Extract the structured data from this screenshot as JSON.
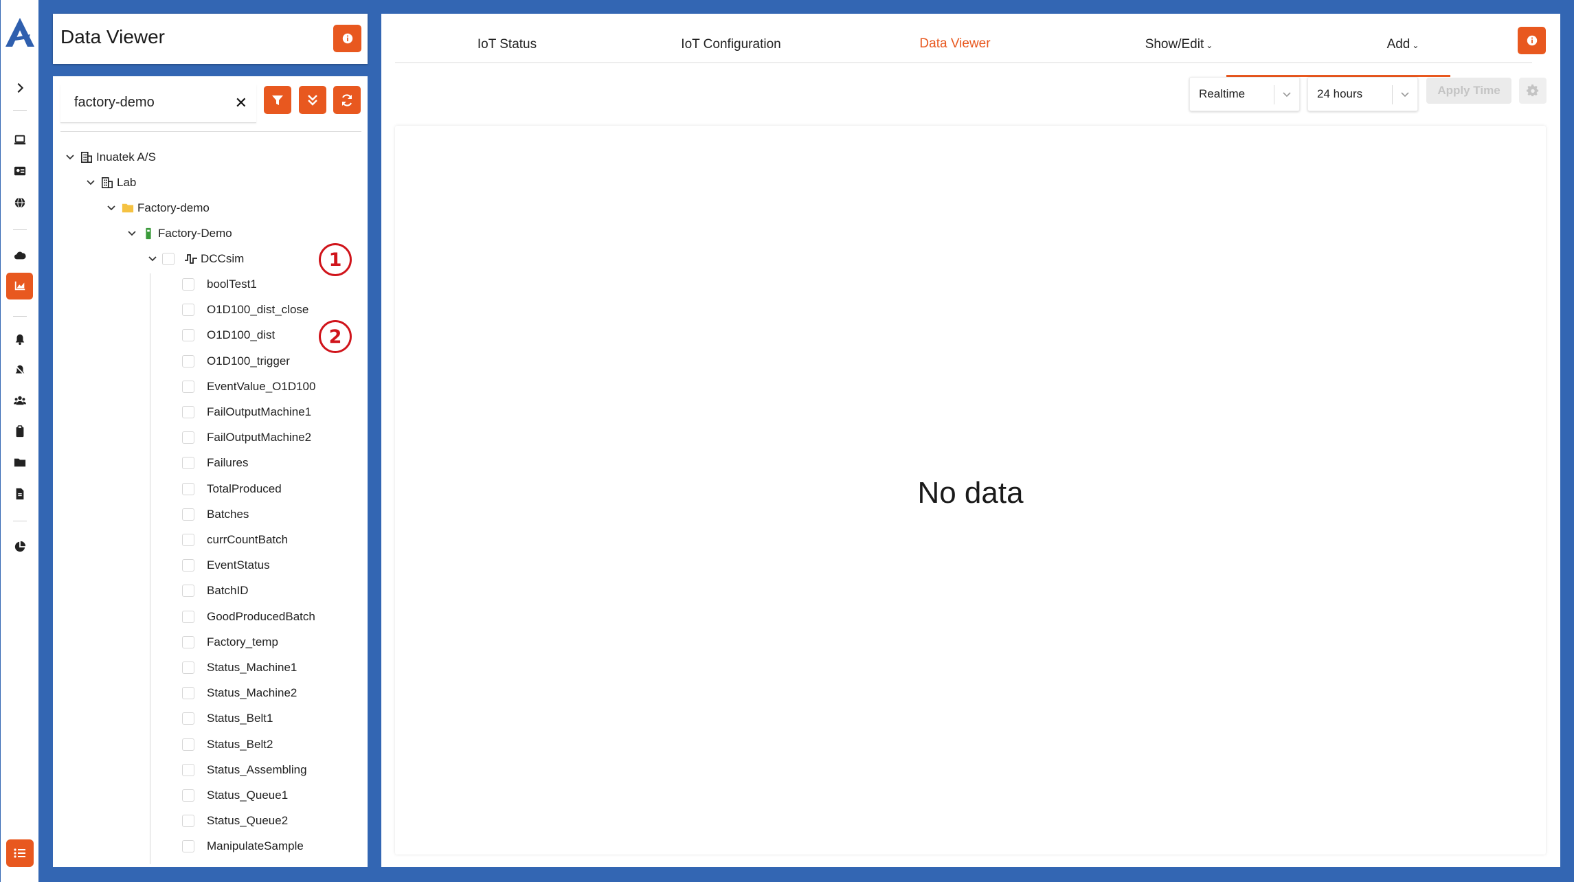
{
  "panel": {
    "title": "Data Viewer"
  },
  "search": {
    "value": "factory-demo",
    "clear": "✕"
  },
  "tree": {
    "org": "Inuatek A/S",
    "site": "Lab",
    "folder": "Factory-demo",
    "device": "Factory-Demo",
    "source": "DCCsim",
    "tags": [
      "boolTest1",
      "O1D100_dist_close",
      "O1D100_dist",
      "O1D100_trigger",
      "EventValue_O1D100",
      "FailOutputMachine1",
      "FailOutputMachine2",
      "Failures",
      "TotalProduced",
      "Batches",
      "currCountBatch",
      "EventStatus",
      "BatchID",
      "GoodProducedBatch",
      "Factory_temp",
      "Status_Machine1",
      "Status_Machine2",
      "Status_Belt1",
      "Status_Belt2",
      "Status_Assembling",
      "Status_Queue1",
      "Status_Queue2",
      "ManipulateSample"
    ]
  },
  "callouts": [
    "1",
    "2"
  ],
  "tabs": {
    "iot_status": "IoT Status",
    "iot_configuration": "IoT Configuration",
    "data_viewer": "Data Viewer",
    "show_edit": "Show/Edit",
    "add": "Add"
  },
  "time": {
    "mode": "Realtime",
    "range": "24 hours",
    "apply": "Apply Time"
  },
  "chart": {
    "empty_message": "No data"
  },
  "colors": {
    "accent": "#e8581f",
    "frame": "#3366b3",
    "callout": "#d0141b"
  },
  "icons": {
    "rail": [
      "logo-icon",
      "expand-icon",
      "laptop-icon",
      "id-card-icon",
      "globe-icon",
      "cloud-icon",
      "chart-icon",
      "bell-icon",
      "bell-off-icon",
      "users-icon",
      "clipboard-icon",
      "folder-icon",
      "document-icon",
      "pie-chart-icon",
      "list-icon"
    ]
  }
}
